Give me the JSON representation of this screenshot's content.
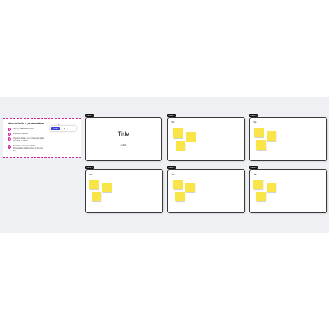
{
  "guide": {
    "title": "How to build a presentation",
    "steps": [
      {
        "num": "1",
        "text": "Set up Presentation Mode"
      },
      {
        "num": "2",
        "text": "Find new columns"
      },
      {
        "num": "3",
        "text": "Organize frames on canvas and adjust the order of slides"
      },
      {
        "num": "4",
        "text": "Start Presenting through the Presentation Mode button on the tool bar"
      }
    ]
  },
  "toolbar": {
    "present_label": "Present",
    "icons": [
      "frame-icon",
      "play-icon",
      "more-icon"
    ]
  },
  "frames": [
    {
      "tag": "Frame 1",
      "label": "",
      "title": "Title",
      "subtitle": "Subtitle",
      "notes": 0
    },
    {
      "tag": "Frame 2",
      "label": "Title",
      "notes": 3
    },
    {
      "tag": "Frame 3",
      "label": "Title",
      "notes": 3
    },
    {
      "tag": "Frame 4",
      "label": "Title",
      "notes": 3
    },
    {
      "tag": "Frame 5",
      "label": "Title",
      "notes": 3
    },
    {
      "tag": "Frame 6",
      "label": "Title",
      "notes": 3
    }
  ],
  "colors": {
    "accent": "#d6249f",
    "sticky": "#f9e547",
    "button": "#3a3fd1",
    "canvas": "#eef0f3"
  }
}
